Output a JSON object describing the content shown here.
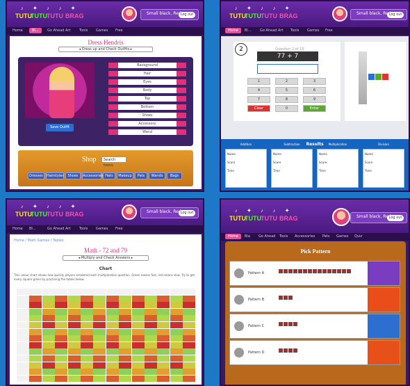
{
  "logo": {
    "line1": "TUTU",
    "line2": "TUTU",
    "line3": "TUTU",
    "line4": "BRAG",
    "deco": "♪ ✦ ♪ ♪ ✦"
  },
  "header": {
    "user_text": "Small black, Red...",
    "pill": "Log out"
  },
  "nav": [
    "Home",
    "Bl...",
    "Go Ahead Art",
    "Tools",
    "Games",
    "Free"
  ],
  "p4_nav": [
    "Home",
    "Bla",
    "Go Ahead",
    "Tools",
    "Accessories",
    "Pets",
    "Games",
    "Quiz"
  ],
  "p1": {
    "title": "Dress Hendris",
    "subtitle": "◂ Dress up and Check Outfits ▸",
    "button": "Save Outfit",
    "options": [
      "Background",
      "Hair",
      "Eyes",
      "Body",
      "Top",
      "Bottom",
      "Shoes",
      "Accessory",
      "Wand"
    ],
    "shop_title": "Shop",
    "shop_input": "Search items",
    "shop_tabs": [
      "Dresses",
      "Hairstyles",
      "Shoes",
      "Accessories",
      "Hats",
      "Makeup",
      "Pets",
      "Wands",
      "Bags"
    ]
  },
  "p2": {
    "number": "2",
    "small": "Question 2 of 10",
    "equation": "77 + 7",
    "keys": [
      "1",
      "2",
      "3",
      "4",
      "5",
      "6",
      "7",
      "8",
      "9",
      "Clear",
      "0",
      "Enter"
    ],
    "results_title": "Results",
    "tables": [
      {
        "title": "Addition",
        "rows": [
          "Name",
          "Score",
          "Time"
        ]
      },
      {
        "title": "Subtraction",
        "rows": [
          "Name",
          "Score",
          "Time"
        ]
      },
      {
        "title": "Multiplication",
        "rows": [
          "Name",
          "Score",
          "Time"
        ]
      },
      {
        "title": "Division",
        "rows": [
          "Name",
          "Score",
          "Time"
        ]
      }
    ]
  },
  "p3": {
    "crumb": "Home / Math Games / Tables",
    "title": "Math - 72 and 79",
    "subtitle": "◂ Multiply and Check Answers ▸",
    "heading": "Chart",
    "text": "This colour chart shows how quickly players answered each multiplication question. Green means fast, red means slow. Try to get every square green by practising the tables below."
  },
  "p4": {
    "title": "Pick Pattern",
    "rows": [
      "Pattern A",
      "Pattern B",
      "Pattern C",
      "Pattern D"
    ]
  },
  "colors": {
    "purple": "#3a1a63",
    "pink": "#e0307c",
    "blue": "#1e78c8",
    "wood": "#b8691c"
  }
}
